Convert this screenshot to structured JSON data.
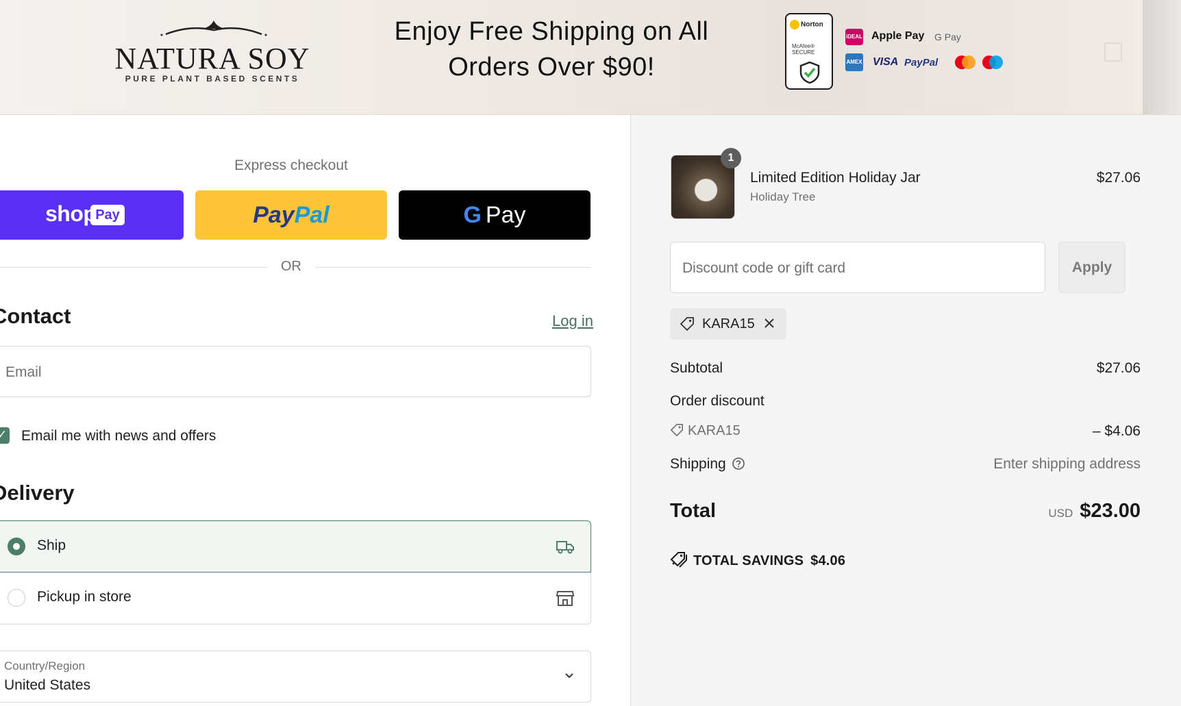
{
  "banner": {
    "brand_name": "NATURA SOY",
    "brand_tagline": "PURE PLANT BASED SCENTS",
    "promo_line1": "Enjoy Free Shipping on All",
    "promo_line2": "Orders Over $90!",
    "trust_badge": {
      "line1": "Norton",
      "line2": "McAfee®",
      "line3": "SECURE"
    },
    "payment_methods": [
      "iDEAL",
      "Apple Pay",
      "G Pay",
      "AMEX",
      "VISA",
      "PayPal",
      "Mastercard",
      "Maestro"
    ]
  },
  "checkout": {
    "express_label": "Express checkout",
    "shop_pay": {
      "word": "shop",
      "pill": "Pay"
    },
    "paypal": {
      "part1": "Pay",
      "part2": "Pal"
    },
    "gpay": {
      "g": "G",
      "label": "Pay"
    },
    "or_label": "OR",
    "contact": {
      "heading": "Contact",
      "login_link": "Log in",
      "email_placeholder": "Email",
      "email_value": "",
      "newsletter_checked": true,
      "newsletter_label": "Email me with news and offers"
    },
    "delivery": {
      "heading": "Delivery",
      "options": [
        {
          "label": "Ship",
          "selected": true,
          "icon": "truck-icon"
        },
        {
          "label": "Pickup in store",
          "selected": false,
          "icon": "store-icon"
        }
      ],
      "country_label": "Country/Region",
      "country_value": "United States"
    }
  },
  "summary": {
    "item": {
      "quantity": "1",
      "name": "Limited Edition Holiday Jar",
      "variant": "Holiday Tree",
      "price": "$27.06"
    },
    "discount_placeholder": "Discount code or gift card",
    "apply_label": "Apply",
    "applied_code": "KARA15",
    "subtotal_label": "Subtotal",
    "subtotal_value": "$27.06",
    "order_discount_label": "Order discount",
    "order_discount_code": "KARA15",
    "order_discount_value": "– $4.06",
    "shipping_label": "Shipping",
    "shipping_value": "Enter shipping address",
    "total_label": "Total",
    "total_currency": "USD",
    "total_value": "$23.00",
    "savings_label": "TOTAL SAVINGS",
    "savings_value": "$4.06"
  },
  "colors": {
    "accent_green": "#4b7f6a",
    "shop_pay_purple": "#5a31f4",
    "paypal_yellow": "#ffc439",
    "summary_bg": "#f5f5f5"
  }
}
